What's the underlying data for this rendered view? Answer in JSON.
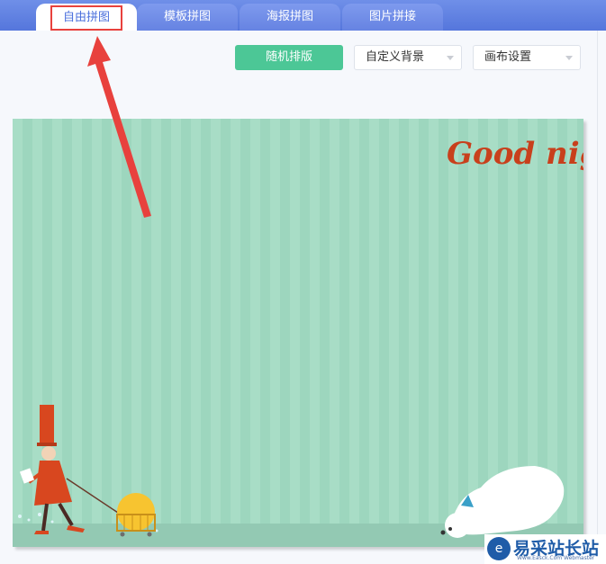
{
  "tabs": [
    {
      "label": "自由拼图"
    },
    {
      "label": "模板拼图"
    },
    {
      "label": "海报拼图"
    },
    {
      "label": "图片拼接"
    }
  ],
  "toolbar": {
    "random_label": "随机排版",
    "background_label": "自定义背景",
    "canvas_label": "画布设置"
  },
  "canvas": {
    "headline": "Good night",
    "background_color": "#a8ddc6",
    "headline_color": "#c8401c"
  },
  "watermark": {
    "title": "易采站长站",
    "url": "Www.Easck.Com  Webmaster"
  },
  "annotation": {
    "color": "#e8413d"
  }
}
